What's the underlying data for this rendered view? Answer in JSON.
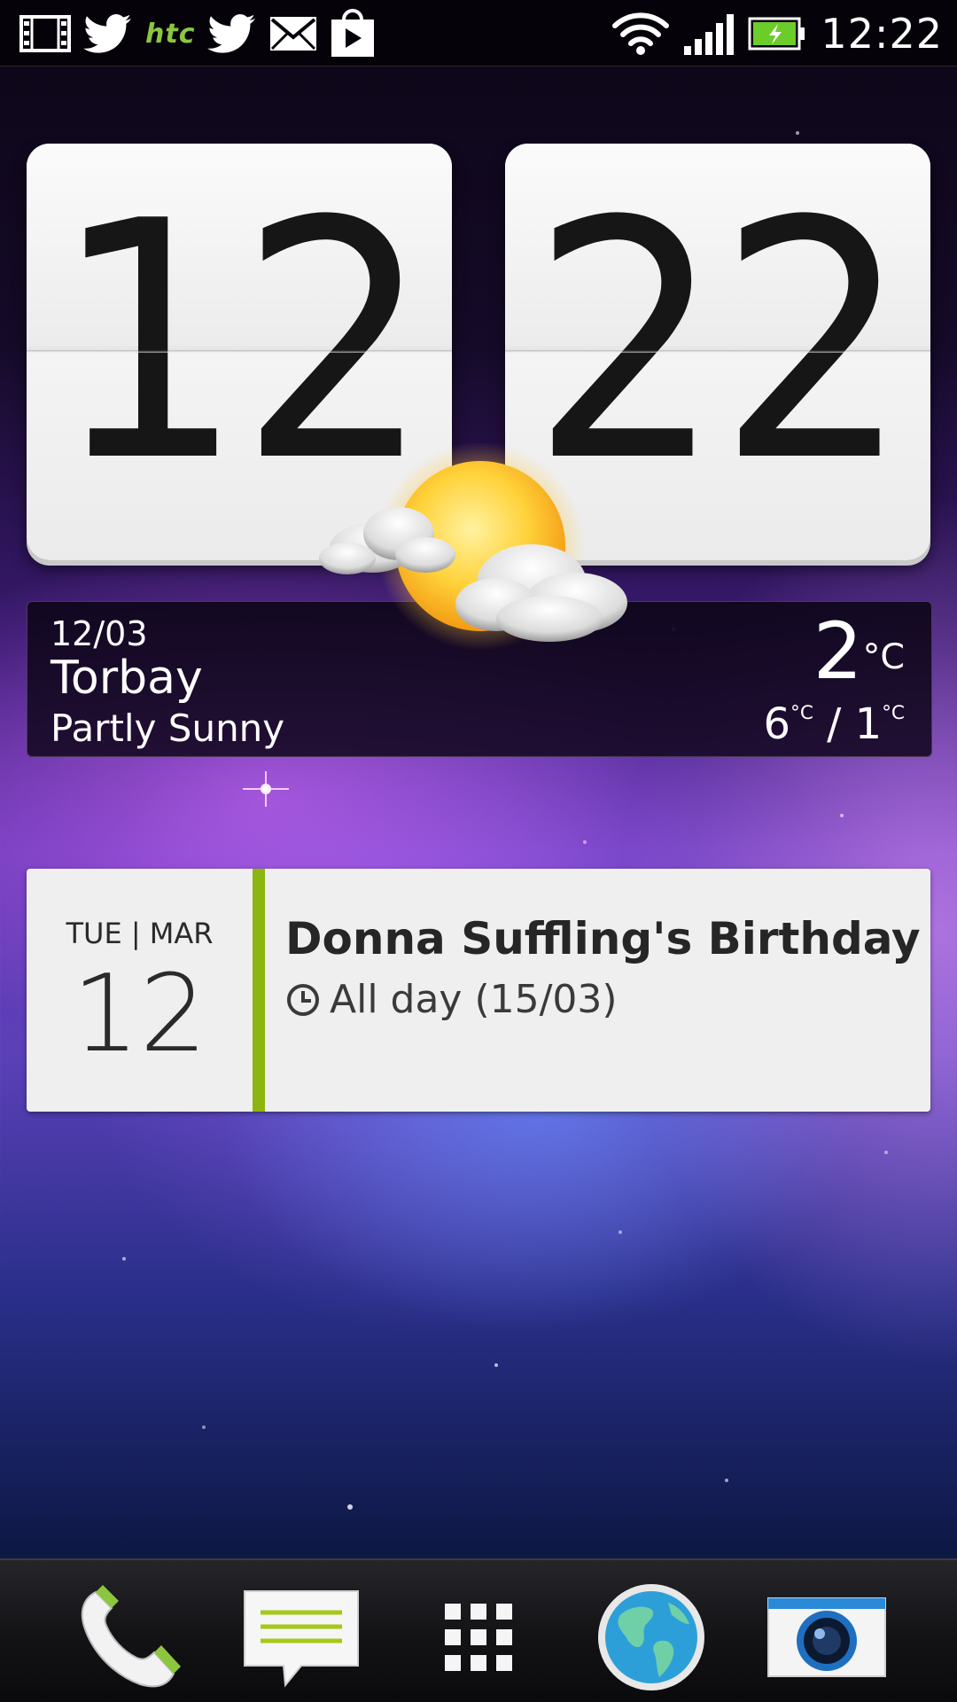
{
  "status_bar": {
    "left_icons": [
      "film-icon",
      "twitter-icon",
      "htc-icon",
      "twitter-icon",
      "mail-icon",
      "play-store-icon"
    ],
    "htc_label": "htc",
    "right_icons": [
      "wifi-icon",
      "signal-icon",
      "battery-charging-icon"
    ],
    "time": "12:22",
    "colors": {
      "htc": "#8cc63f",
      "battery": "#6ccc2a"
    }
  },
  "clock": {
    "hours": "12",
    "minutes": "22"
  },
  "weather": {
    "date": "12/03",
    "city": "Torbay",
    "condition": "Partly Sunny",
    "temp_value": "2",
    "temp_unit": "°C",
    "high_value": "6",
    "high_unit": "°C",
    "separator": " / ",
    "low_value": "1",
    "low_unit": "°C",
    "icon": "partly-sunny-icon"
  },
  "calendar": {
    "day_of_week_month": "TUE | MAR",
    "day": "12",
    "event_title": "Donna Suffling's Birthday",
    "event_time": "All day (15/03)",
    "accent_color": "#8cb50f"
  },
  "dock": {
    "items": [
      "phone-icon",
      "messages-icon",
      "app-drawer-icon",
      "browser-icon",
      "camera-icon"
    ]
  }
}
